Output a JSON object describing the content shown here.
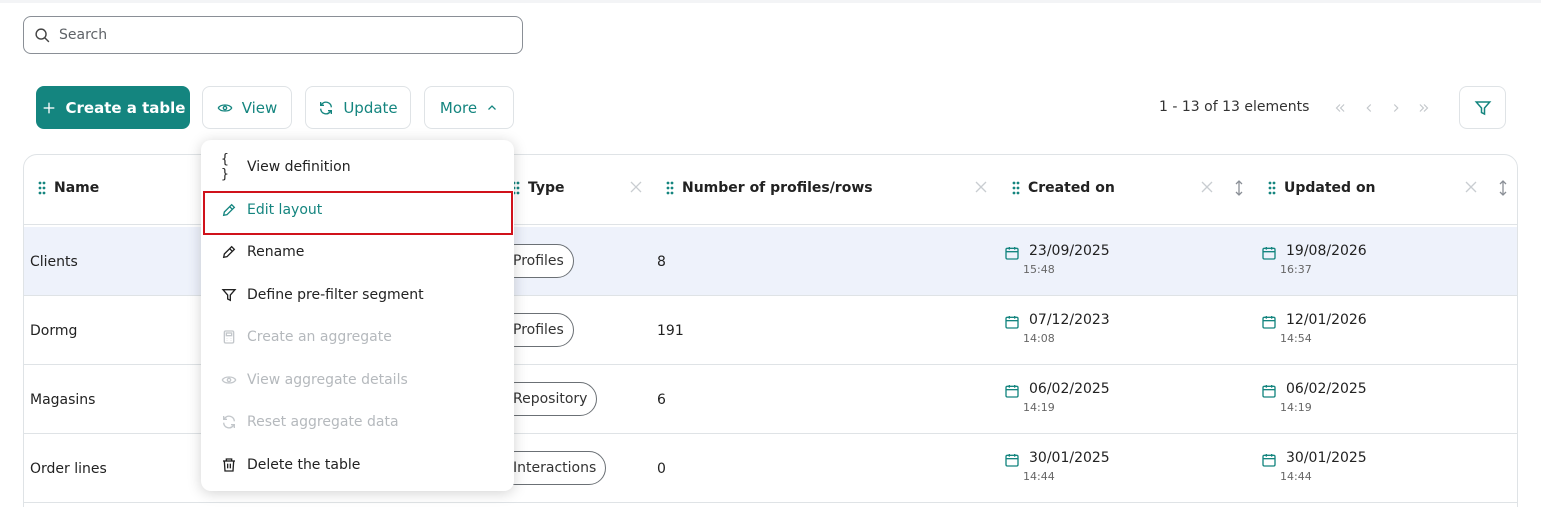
{
  "search": {
    "placeholder": "Search",
    "value": ""
  },
  "toolbar": {
    "create_label": "Create a table",
    "view_label": "View",
    "update_label": "Update",
    "more_label": "More"
  },
  "pagination": {
    "text": "1 - 13 of 13 elements"
  },
  "table": {
    "columns": [
      {
        "label": "Name"
      },
      {
        "label": "Type"
      },
      {
        "label": "Number of profiles/rows"
      },
      {
        "label": "Created on"
      },
      {
        "label": "Updated on"
      }
    ],
    "rows": [
      {
        "name": "Clients",
        "type": "Profiles",
        "count": "8",
        "created_date": "23/09/2025",
        "created_time": "15:48",
        "updated_date": "19/08/2026",
        "updated_time": "16:37",
        "selected": true
      },
      {
        "name": "Dormg",
        "type": "Profiles",
        "count": "191",
        "created_date": "07/12/2023",
        "created_time": "14:08",
        "updated_date": "12/01/2026",
        "updated_time": "14:54",
        "selected": false
      },
      {
        "name": "Magasins",
        "type": "Repository",
        "count": "6",
        "created_date": "06/02/2025",
        "created_time": "14:19",
        "updated_date": "06/02/2025",
        "updated_time": "14:19",
        "selected": false
      },
      {
        "name": "Order lines",
        "type": "Interactions",
        "count": "0",
        "created_date": "30/01/2025",
        "created_time": "14:44",
        "updated_date": "30/01/2025",
        "updated_time": "14:44",
        "selected": false
      }
    ]
  },
  "menu": {
    "items": [
      {
        "label": "View definition",
        "icon": "braces-icon",
        "disabled": false
      },
      {
        "label": "Edit layout",
        "icon": "pencil-icon",
        "disabled": false
      },
      {
        "label": "Rename",
        "icon": "pencil-icon",
        "disabled": false
      },
      {
        "label": "Define pre-filter segment",
        "icon": "filter-icon",
        "disabled": false
      },
      {
        "label": "Create an aggregate",
        "icon": "calculator-icon",
        "disabled": true
      },
      {
        "label": "View aggregate details",
        "icon": "eye-icon",
        "disabled": true
      },
      {
        "label": "Reset aggregate data",
        "icon": "refresh-icon",
        "disabled": true
      },
      {
        "label": "Delete the table",
        "icon": "trash-icon",
        "disabled": false
      }
    ]
  },
  "colors": {
    "accent": "#14857f",
    "highlight": "#d0121b",
    "selected_row": "#eef2fb",
    "disabled": "#b5b9bd"
  }
}
